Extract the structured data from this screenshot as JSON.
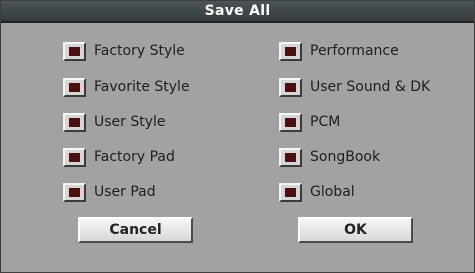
{
  "dialog": {
    "title": "Save All",
    "left_options": [
      {
        "label": "Factory Style",
        "checked": true
      },
      {
        "label": "Favorite Style",
        "checked": true
      },
      {
        "label": "User Style",
        "checked": true
      },
      {
        "label": "Factory Pad",
        "checked": true
      },
      {
        "label": "User Pad",
        "checked": true
      }
    ],
    "right_options": [
      {
        "label": "Performance",
        "checked": true
      },
      {
        "label": "User Sound & DK",
        "checked": true
      },
      {
        "label": "PCM",
        "checked": true
      },
      {
        "label": "SongBook",
        "checked": true
      },
      {
        "label": "Global",
        "checked": true
      }
    ],
    "cancel_label": "Cancel",
    "ok_label": "OK"
  },
  "colors": {
    "dialog_background": "#a2a2a2",
    "titlebar": "#3f4649",
    "check_mark": "#4a0f0f"
  }
}
